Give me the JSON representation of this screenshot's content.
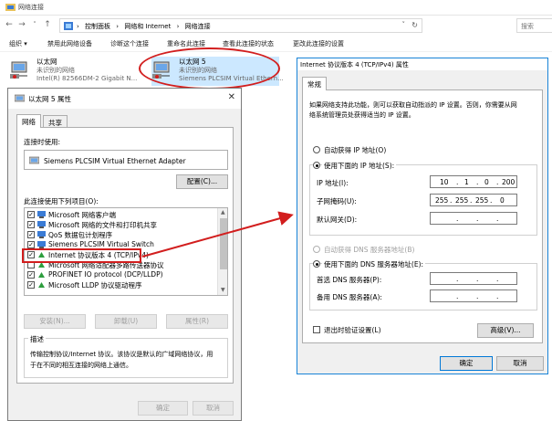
{
  "explorer": {
    "title": "网络连接",
    "breadcrumb": [
      "控制面板",
      "›",
      "网络和 Internet",
      "›",
      "网络连接"
    ],
    "search_placeholder": "搜索",
    "commands": [
      "组织 ▾",
      "禁用此网络设备",
      "诊断这个连接",
      "重命名此连接",
      "查看此连接的状态",
      "更改此连接的设置"
    ],
    "connections": [
      {
        "name": "以太网",
        "status": "未识别的网络",
        "device": "Intel(R) 82566DM-2 Gigabit N..."
      },
      {
        "name": "以太网 5",
        "status": "未识别的网络",
        "device": "Siemens PLCSIM Virtual Ethern..."
      }
    ]
  },
  "eth_dialog": {
    "title": "以太网 5 属性",
    "close": "✕",
    "tabs": [
      "网络",
      "共享"
    ],
    "connect_using_label": "连接时使用:",
    "adapter_name": "Siemens PLCSIM Virtual Ethernet Adapter",
    "configure_button": "配置(C)...",
    "items_label": "此连接使用下列项目(O):",
    "items": [
      {
        "checked": true,
        "label": "Microsoft 网络客户端"
      },
      {
        "checked": true,
        "label": "Microsoft 网络的文件和打印机共享"
      },
      {
        "checked": true,
        "label": "QoS 数据包计划程序"
      },
      {
        "checked": true,
        "label": "Siemens PLCSIM Virtual Switch"
      },
      {
        "checked": true,
        "label": "Internet 协议版本 4 (TCP/IPv4)"
      },
      {
        "checked": false,
        "label": "Microsoft 网络适配器多路传送器协议"
      },
      {
        "checked": true,
        "label": "PROFINET IO protocol (DCP/LLDP)"
      },
      {
        "checked": true,
        "label": "Microsoft LLDP 协议驱动程序"
      }
    ],
    "install_button": "安装(N)...",
    "uninstall_button": "卸载(U)",
    "properties_button": "属性(R)",
    "description_label": "描述",
    "description_text_1": "传输控制协议/Internet 协议。该协议是默认的广域网络协议，用",
    "description_text_2": "于在不同的相互连接的网络上通信。",
    "ok_button": "确定",
    "cancel_button": "取消"
  },
  "ipv4_dialog": {
    "title": "Internet 协议版本 4 (TCP/IPv4) 属性",
    "tab": "常规",
    "intro_1": "如果网络支持此功能，则可以获取自动指派的 IP 设置。否则，你需要从网",
    "intro_2": "络系统管理员处获得适当的 IP 设置。",
    "auto_ip": "自动获得 IP 地址(O)",
    "manual_ip": "使用下面的 IP 地址(S):",
    "ip_label": "IP 地址(I):",
    "ip_value": [
      "10",
      "1",
      "0",
      "200"
    ],
    "mask_label": "子网掩码(U):",
    "mask_value": [
      "255",
      "255",
      "255",
      "0"
    ],
    "gateway_label": "默认网关(D):",
    "auto_dns": "自动获得 DNS 服务器地址(B)",
    "manual_dns": "使用下面的 DNS 服务器地址(E):",
    "dns1_label": "首选 DNS 服务器(P):",
    "dns2_label": "备用 DNS 服务器(A):",
    "validate_label": "退出时验证设置(L)",
    "advanced_button": "高级(V)...",
    "ok_button": "确定",
    "cancel_button": "取消"
  },
  "colors": {
    "annotation": "#d21e1e",
    "accent": "#0078d7"
  }
}
